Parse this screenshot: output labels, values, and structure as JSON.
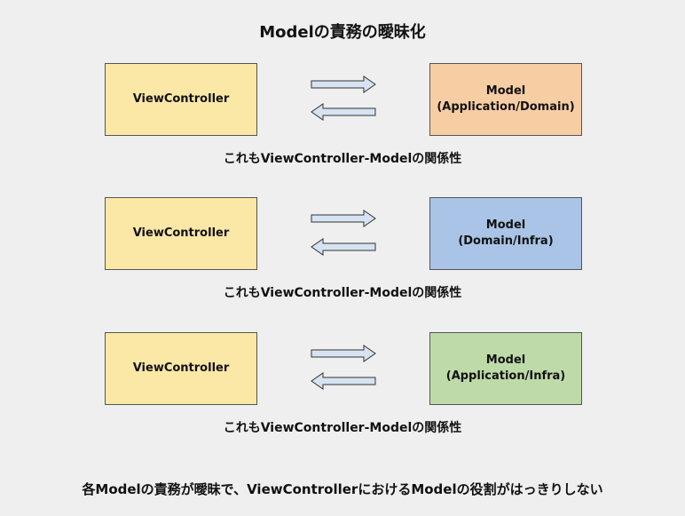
{
  "title": "Modelの責務の曖昧化",
  "rows": [
    {
      "left_label": "ViewController",
      "right_label": "Model\n(Application/Domain)",
      "right_color": "#f7cda3",
      "caption": "これもViewController-Modelの関係性"
    },
    {
      "left_label": "ViewController",
      "right_label": "Model\n(Domain/Infra)",
      "right_color": "#a9c4e6",
      "caption": "これもViewController-Modelの関係性"
    },
    {
      "left_label": "ViewController",
      "right_label": "Model\n(Application/Infra)",
      "right_color": "#bfdaa9",
      "caption": "これもViewController-Modelの関係性"
    }
  ],
  "arrow_color": "#d7e3f2",
  "left_box_color": "#fce8a6",
  "footer": "各Modelの責務が曖昧で、ViewControllerにおけるModelの役割がはっきりしない"
}
